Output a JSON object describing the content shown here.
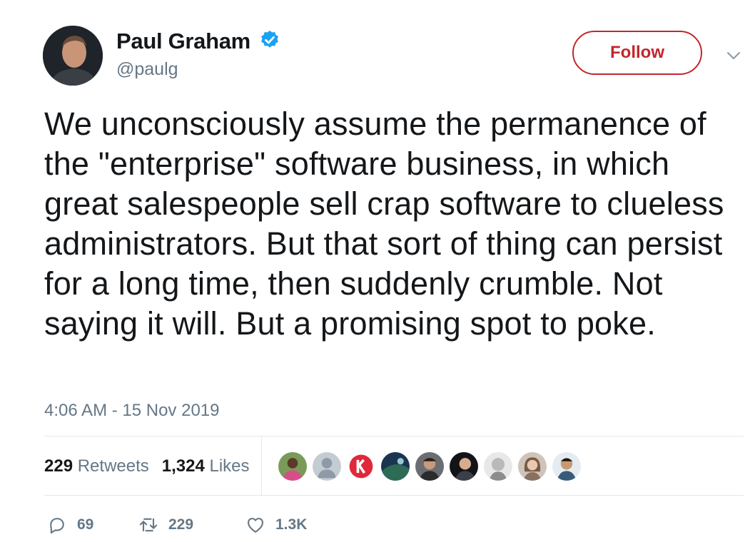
{
  "author": {
    "name": "Paul Graham",
    "handle": "@paulg",
    "verified": true
  },
  "follow_label": "Follow",
  "tweet_text": "We unconsciously assume the permanence of the \"enterprise\" software business, in which great salespeople sell crap software to clueless administrators. But that sort of thing can persist for a long time, then suddenly crumble. Not saying it will. But a promising spot to poke.",
  "timestamp": "4:06 AM - 15 Nov 2019",
  "stats": {
    "retweets_count": "229",
    "retweets_label": "Retweets",
    "likes_count": "1,324",
    "likes_label": "Likes"
  },
  "actions": {
    "replies": "69",
    "retweets": "229",
    "likes": "1.3K"
  },
  "colors": {
    "accent": "#c1272d",
    "verified": "#1da1f2",
    "muted": "#657786",
    "text": "#14171a",
    "divider": "#e1e8ed"
  },
  "icons": [
    "verified-badge-icon",
    "chevron-down-icon",
    "reply-icon",
    "retweet-icon",
    "heart-icon"
  ]
}
